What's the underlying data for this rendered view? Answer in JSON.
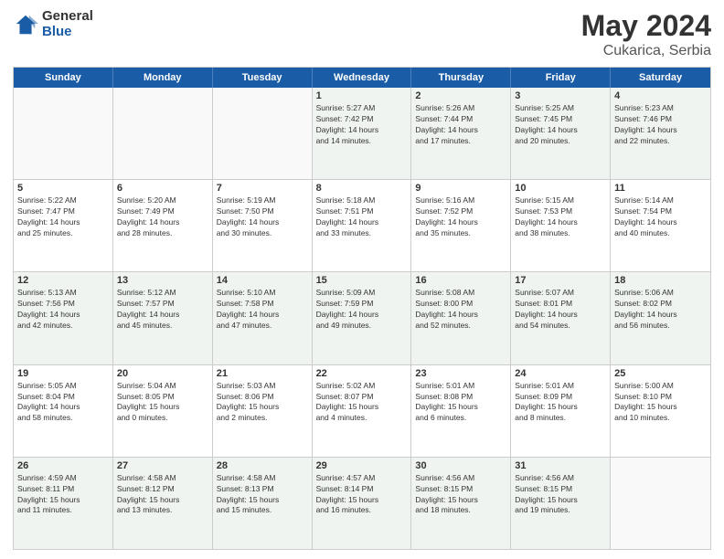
{
  "logo": {
    "general": "General",
    "blue": "Blue"
  },
  "title": {
    "month": "May 2024",
    "location": "Cukarica, Serbia"
  },
  "weekdays": [
    "Sunday",
    "Monday",
    "Tuesday",
    "Wednesday",
    "Thursday",
    "Friday",
    "Saturday"
  ],
  "weeks": [
    [
      {
        "day": "",
        "info": ""
      },
      {
        "day": "",
        "info": ""
      },
      {
        "day": "",
        "info": ""
      },
      {
        "day": "1",
        "info": "Sunrise: 5:27 AM\nSunset: 7:42 PM\nDaylight: 14 hours\nand 14 minutes."
      },
      {
        "day": "2",
        "info": "Sunrise: 5:26 AM\nSunset: 7:44 PM\nDaylight: 14 hours\nand 17 minutes."
      },
      {
        "day": "3",
        "info": "Sunrise: 5:25 AM\nSunset: 7:45 PM\nDaylight: 14 hours\nand 20 minutes."
      },
      {
        "day": "4",
        "info": "Sunrise: 5:23 AM\nSunset: 7:46 PM\nDaylight: 14 hours\nand 22 minutes."
      }
    ],
    [
      {
        "day": "5",
        "info": "Sunrise: 5:22 AM\nSunset: 7:47 PM\nDaylight: 14 hours\nand 25 minutes."
      },
      {
        "day": "6",
        "info": "Sunrise: 5:20 AM\nSunset: 7:49 PM\nDaylight: 14 hours\nand 28 minutes."
      },
      {
        "day": "7",
        "info": "Sunrise: 5:19 AM\nSunset: 7:50 PM\nDaylight: 14 hours\nand 30 minutes."
      },
      {
        "day": "8",
        "info": "Sunrise: 5:18 AM\nSunset: 7:51 PM\nDaylight: 14 hours\nand 33 minutes."
      },
      {
        "day": "9",
        "info": "Sunrise: 5:16 AM\nSunset: 7:52 PM\nDaylight: 14 hours\nand 35 minutes."
      },
      {
        "day": "10",
        "info": "Sunrise: 5:15 AM\nSunset: 7:53 PM\nDaylight: 14 hours\nand 38 minutes."
      },
      {
        "day": "11",
        "info": "Sunrise: 5:14 AM\nSunset: 7:54 PM\nDaylight: 14 hours\nand 40 minutes."
      }
    ],
    [
      {
        "day": "12",
        "info": "Sunrise: 5:13 AM\nSunset: 7:56 PM\nDaylight: 14 hours\nand 42 minutes."
      },
      {
        "day": "13",
        "info": "Sunrise: 5:12 AM\nSunset: 7:57 PM\nDaylight: 14 hours\nand 45 minutes."
      },
      {
        "day": "14",
        "info": "Sunrise: 5:10 AM\nSunset: 7:58 PM\nDaylight: 14 hours\nand 47 minutes."
      },
      {
        "day": "15",
        "info": "Sunrise: 5:09 AM\nSunset: 7:59 PM\nDaylight: 14 hours\nand 49 minutes."
      },
      {
        "day": "16",
        "info": "Sunrise: 5:08 AM\nSunset: 8:00 PM\nDaylight: 14 hours\nand 52 minutes."
      },
      {
        "day": "17",
        "info": "Sunrise: 5:07 AM\nSunset: 8:01 PM\nDaylight: 14 hours\nand 54 minutes."
      },
      {
        "day": "18",
        "info": "Sunrise: 5:06 AM\nSunset: 8:02 PM\nDaylight: 14 hours\nand 56 minutes."
      }
    ],
    [
      {
        "day": "19",
        "info": "Sunrise: 5:05 AM\nSunset: 8:04 PM\nDaylight: 14 hours\nand 58 minutes."
      },
      {
        "day": "20",
        "info": "Sunrise: 5:04 AM\nSunset: 8:05 PM\nDaylight: 15 hours\nand 0 minutes."
      },
      {
        "day": "21",
        "info": "Sunrise: 5:03 AM\nSunset: 8:06 PM\nDaylight: 15 hours\nand 2 minutes."
      },
      {
        "day": "22",
        "info": "Sunrise: 5:02 AM\nSunset: 8:07 PM\nDaylight: 15 hours\nand 4 minutes."
      },
      {
        "day": "23",
        "info": "Sunrise: 5:01 AM\nSunset: 8:08 PM\nDaylight: 15 hours\nand 6 minutes."
      },
      {
        "day": "24",
        "info": "Sunrise: 5:01 AM\nSunset: 8:09 PM\nDaylight: 15 hours\nand 8 minutes."
      },
      {
        "day": "25",
        "info": "Sunrise: 5:00 AM\nSunset: 8:10 PM\nDaylight: 15 hours\nand 10 minutes."
      }
    ],
    [
      {
        "day": "26",
        "info": "Sunrise: 4:59 AM\nSunset: 8:11 PM\nDaylight: 15 hours\nand 11 minutes."
      },
      {
        "day": "27",
        "info": "Sunrise: 4:58 AM\nSunset: 8:12 PM\nDaylight: 15 hours\nand 13 minutes."
      },
      {
        "day": "28",
        "info": "Sunrise: 4:58 AM\nSunset: 8:13 PM\nDaylight: 15 hours\nand 15 minutes."
      },
      {
        "day": "29",
        "info": "Sunrise: 4:57 AM\nSunset: 8:14 PM\nDaylight: 15 hours\nand 16 minutes."
      },
      {
        "day": "30",
        "info": "Sunrise: 4:56 AM\nSunset: 8:15 PM\nDaylight: 15 hours\nand 18 minutes."
      },
      {
        "day": "31",
        "info": "Sunrise: 4:56 AM\nSunset: 8:15 PM\nDaylight: 15 hours\nand 19 minutes."
      },
      {
        "day": "",
        "info": ""
      }
    ]
  ]
}
